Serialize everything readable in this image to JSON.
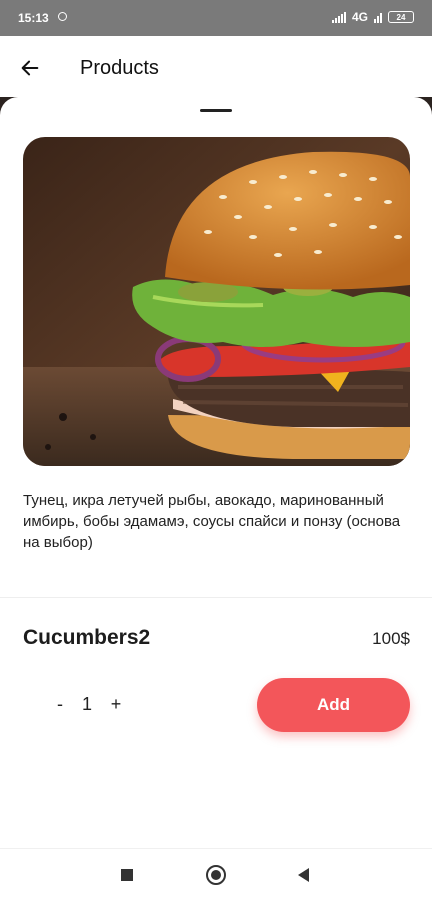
{
  "status_bar": {
    "time": "15:13",
    "network": "4G",
    "battery": "24"
  },
  "app_bar": {
    "title": "Products",
    "back_icon": "arrow-left-icon"
  },
  "product": {
    "image": "burger-photo",
    "description": "Тунец, икра летучей рыбы, авокадо, маринованный имбирь, бобы эдамамэ, соусы спайси и понзу (основа на выбор)",
    "name": "Cucumbers2",
    "price": "100$"
  },
  "quantity": {
    "minus_label": "-",
    "value": "1",
    "plus_label": "+"
  },
  "actions": {
    "add_label": "Add"
  },
  "colors": {
    "accent": "#f3565a",
    "status_bar": "#7a7a7a"
  },
  "nav_bar": {
    "icons": [
      "recents-square-icon",
      "home-circle-icon",
      "back-triangle-icon"
    ]
  }
}
